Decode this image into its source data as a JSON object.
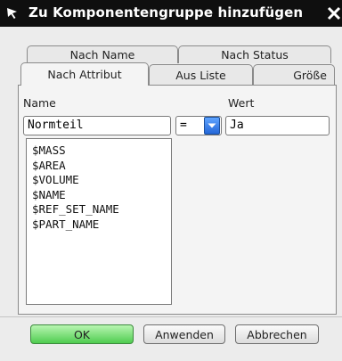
{
  "window": {
    "title": "Zu Komponentengruppe hinzufügen"
  },
  "tabs": {
    "row_back": [
      "Nach Name",
      "Nach Status"
    ],
    "row_front": [
      "Nach Attribut",
      "Aus Liste",
      "Größe"
    ],
    "active": "Nach Attribut"
  },
  "form": {
    "name_label": "Name",
    "value_label": "Wert",
    "name_value": "Normteil",
    "operator_value": "=",
    "value_value": "Ja"
  },
  "attributes": [
    "$MASS",
    "$AREA",
    "$VOLUME",
    "$NAME",
    "$REF_SET_NAME",
    "$PART_NAME"
  ],
  "buttons": {
    "ok": "OK",
    "apply": "Anwenden",
    "cancel": "Abbrechen"
  },
  "colors": {
    "titlebar": "#0f0f0f",
    "ok_button": "#4fcc50",
    "dropdown_button": "#2467d8"
  }
}
